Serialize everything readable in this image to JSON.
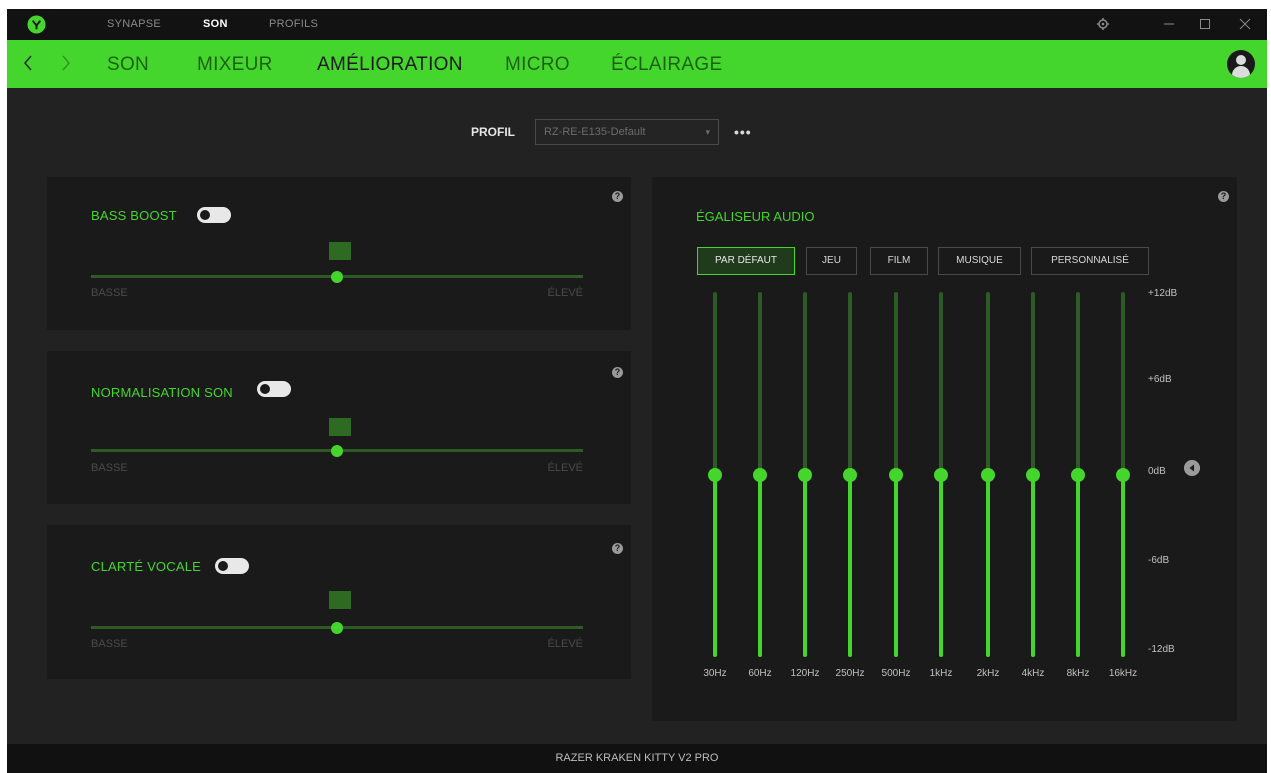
{
  "topnav": {
    "synapse": "SYNAPSE",
    "son": "SON",
    "profils": "PROFILS"
  },
  "tabs": [
    "SON",
    "MIXEUR",
    "AMÉLIORATION",
    "MICRO",
    "ÉCLAIRAGE"
  ],
  "active_tab": "AMÉLIORATION",
  "profile": {
    "label": "PROFIL",
    "value": "RZ-RE-E135-Default"
  },
  "panels": [
    {
      "title": "BASS BOOST",
      "enabled": true,
      "slider_value": 0.5,
      "low": "BASSE",
      "high": "ÉLEVÉ"
    },
    {
      "title": "NORMALISATION SON",
      "enabled": true,
      "slider_value": 0.5,
      "low": "BASSE",
      "high": "ÉLEVÉ"
    },
    {
      "title": "CLARTÉ VOCALE",
      "enabled": true,
      "slider_value": 0.5,
      "low": "BASSE",
      "high": "ÉLEVÉ"
    }
  ],
  "equalizer": {
    "title": "ÉGALISEUR AUDIO",
    "presets": [
      "PAR DÉFAUT",
      "JEU",
      "FILM",
      "MUSIQUE",
      "PERSONNALISÉ"
    ],
    "active_preset": "PAR DÉFAUT",
    "bands": [
      {
        "freq": "30Hz",
        "gain_db": 0
      },
      {
        "freq": "60Hz",
        "gain_db": 0
      },
      {
        "freq": "120Hz",
        "gain_db": 0
      },
      {
        "freq": "250Hz",
        "gain_db": 0
      },
      {
        "freq": "500Hz",
        "gain_db": 0
      },
      {
        "freq": "1kHz",
        "gain_db": 0
      },
      {
        "freq": "2kHz",
        "gain_db": 0
      },
      {
        "freq": "4kHz",
        "gain_db": 0
      },
      {
        "freq": "8kHz",
        "gain_db": 0
      },
      {
        "freq": "16kHz",
        "gain_db": 0
      }
    ],
    "db_labels": [
      "+12dB",
      "+6dB",
      "0dB",
      "-6dB",
      "-12dB"
    ],
    "range_db": [
      -12,
      12
    ]
  },
  "device_name": "RAZER KRAKEN KITTY V2 PRO",
  "colors": {
    "accent": "#44d62c",
    "background": "#222222",
    "panel": "#1a1a1a"
  }
}
